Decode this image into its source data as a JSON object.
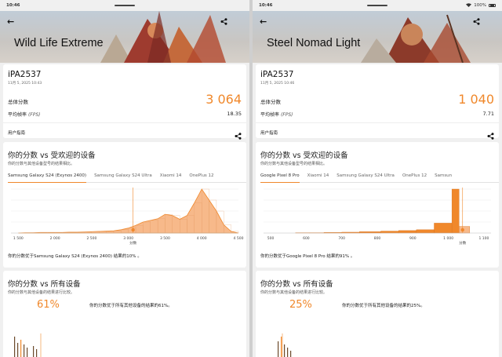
{
  "status_bar": {
    "time": "10:46",
    "signal_icon": "wifi-icon",
    "battery_percent": "100%"
  },
  "panels": [
    {
      "title": "Wild Life Extreme",
      "device": "iPA2537",
      "datetime": "11月 5, 2025 10:43",
      "score_label": "总体分数",
      "score": "3 064",
      "fps_label": "平均帧率",
      "fps_unit": "(FPS)",
      "fps": "18.35",
      "guide_label": "用户指南",
      "compare_title_a": "你的分数",
      "compare_title_vs": "vs",
      "compare_title_b": "受欢迎的设备",
      "compare_subtitle": "你的分数与其他设备型号的结果相比。",
      "tabs": [
        "Samsung Galaxy S24 (Exynos 2400)",
        "Samsung Galaxy S24 Ultra",
        "Xiaomi 14",
        "OnePlus 12"
      ],
      "active_tab": 0,
      "compare_footer": "你的分数优于Samsung Galaxy S24 (Exynos 2400) 结果的10% 。",
      "all_title_a": "你的分数",
      "all_title_vs": "vs",
      "all_title_b": "所有设备",
      "all_subtitle": "你的分数与其他设备的结果进行比较。",
      "all_percent": "61%",
      "all_text": "你的分数优于所有其他设备的结果的61%。"
    },
    {
      "title": "Steel Nomad Light",
      "device": "iPA2537",
      "datetime": "11月 5, 2025 10:46",
      "score_label": "总体分数",
      "score": "1 040",
      "fps_label": "平均帧率",
      "fps_unit": "(FPS)",
      "fps": "7.71",
      "guide_label": "用户指南",
      "compare_title_a": "你的分数",
      "compare_title_vs": "vs",
      "compare_title_b": "受欢迎的设备",
      "compare_subtitle": "你的分数与其他设备型号的结果相比。",
      "tabs": [
        "Google Pixel 8 Pro",
        "Xiaomi 14",
        "Samsung Galaxy S24 Ultra",
        "OnePlus 12",
        "Samsun"
      ],
      "active_tab": 0,
      "compare_footer": "你的分数优于Google Pixel 8 Pro 结果的91% 。",
      "all_title_a": "你的分数",
      "all_title_vs": "vs",
      "all_title_b": "所有设备",
      "all_subtitle": "你的分数与其他设备的结果进行比较。",
      "all_percent": "25%",
      "all_text": "你的分数优于所有其他设备的结果的25%。"
    }
  ],
  "colors": {
    "accent": "#f0882b",
    "accent_fill": "#f7b98a",
    "bar_fill": "#f0882b"
  },
  "chart_data": [
    {
      "type": "area",
      "x_ticks": [
        "1 500",
        "2 000",
        "2 500",
        "3 000",
        "3 500",
        "4 000",
        "4 500"
      ],
      "x_axis_label": "分数",
      "xlim": [
        1400,
        4500
      ],
      "marker_score": 3064,
      "x": [
        1500,
        1600,
        1700,
        1800,
        1900,
        2000,
        2100,
        2200,
        2300,
        2400,
        2500,
        2600,
        2700,
        2800,
        2900,
        3000,
        3100,
        3200,
        3300,
        3400,
        3500,
        3600,
        3700,
        3800,
        3900,
        4000,
        4100,
        4200,
        4300,
        4400,
        4500
      ],
      "y": [
        0,
        0.5,
        0.5,
        1,
        1,
        1,
        1,
        1.5,
        1.5,
        2,
        2.5,
        3,
        3.5,
        4,
        6,
        9,
        14,
        20,
        23,
        26,
        34,
        32,
        25,
        32,
        55,
        80,
        60,
        40,
        15,
        3,
        0
      ]
    },
    {
      "type": "bar",
      "x_ticks": [
        "500",
        "600",
        "700",
        "800",
        "900",
        "1 000",
        "1 100"
      ],
      "x_axis_label": "分数",
      "xlim": [
        480,
        1120
      ],
      "marker_score": 1040,
      "bins": [
        [
          480,
          570
        ],
        [
          570,
          610
        ],
        [
          610,
          650
        ],
        [
          650,
          700
        ],
        [
          700,
          750
        ],
        [
          750,
          810
        ],
        [
          810,
          860
        ],
        [
          860,
          910
        ],
        [
          910,
          960
        ],
        [
          960,
          1010
        ],
        [
          1010,
          1030
        ],
        [
          1030,
          1060
        ]
      ],
      "values": [
        0,
        0.5,
        0.5,
        1,
        1.5,
        2.5,
        3.5,
        4.5,
        6,
        18,
        80,
        12
      ]
    }
  ]
}
